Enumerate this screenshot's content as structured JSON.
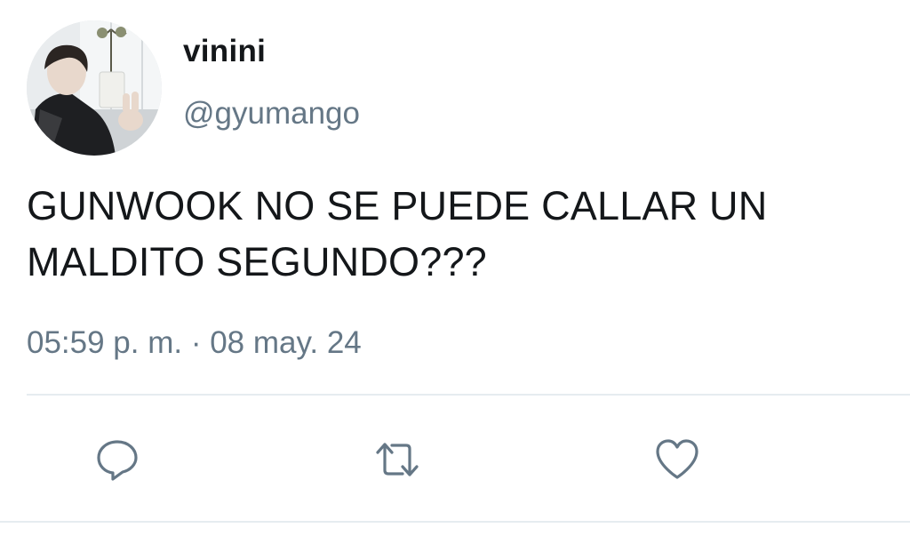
{
  "user": {
    "display_name": "vinini",
    "handle": "@gyumango",
    "avatar_icon": "profile-photo"
  },
  "tweet": {
    "text": "GUNWOOK NO SE PUEDE CALLAR UN MALDITO SEGUNDO???",
    "timestamp": "05:59 p. m. · 08 may. 24"
  },
  "actions": [
    {
      "name": "reply",
      "icon": "reply-icon"
    },
    {
      "name": "retweet",
      "icon": "retweet-icon"
    },
    {
      "name": "like",
      "icon": "heart-icon"
    }
  ],
  "colors": {
    "text": "#14171a",
    "secondary": "#657786",
    "icon": "#657786",
    "divider": "#e6ecf0"
  }
}
